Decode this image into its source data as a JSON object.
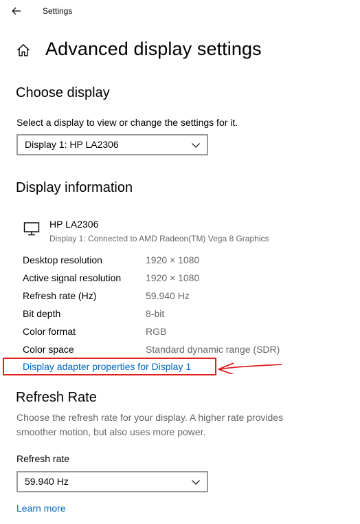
{
  "window": {
    "title": "Settings",
    "back_icon": "back-arrow-icon"
  },
  "header": {
    "title": "Advanced display settings",
    "home_icon": "home-icon"
  },
  "choose_display": {
    "heading": "Choose display",
    "description": "Select a display to view or change the settings for it.",
    "selected": "Display 1: HP LA2306"
  },
  "display_info": {
    "heading": "Display information",
    "monitor_icon": "monitor-icon",
    "monitor_name": "HP LA2306",
    "monitor_subtitle": "Display 1: Connected to AMD Radeon(TM) Vega 8 Graphics",
    "rows": [
      {
        "label": "Desktop resolution",
        "value": "1920 × 1080"
      },
      {
        "label": "Active signal resolution",
        "value": "1920 × 1080"
      },
      {
        "label": "Refresh rate (Hz)",
        "value": "59.940 Hz"
      },
      {
        "label": "Bit depth",
        "value": "8-bit"
      },
      {
        "label": "Color format",
        "value": "RGB"
      },
      {
        "label": "Color space",
        "value": "Standard dynamic range (SDR)"
      }
    ],
    "adapter_link": "Display adapter properties for Display 1"
  },
  "refresh_rate": {
    "heading": "Refresh Rate",
    "description_line1": "Choose the refresh rate for your display. A higher rate provides",
    "description_line2": "smoother motion, but also uses more power.",
    "dropdown_label": "Refresh rate",
    "selected": "59.940 Hz",
    "learn_more": "Learn more"
  },
  "colors": {
    "link": "#0067c0",
    "annotation": "#e02020",
    "secondary_text": "#666666"
  }
}
